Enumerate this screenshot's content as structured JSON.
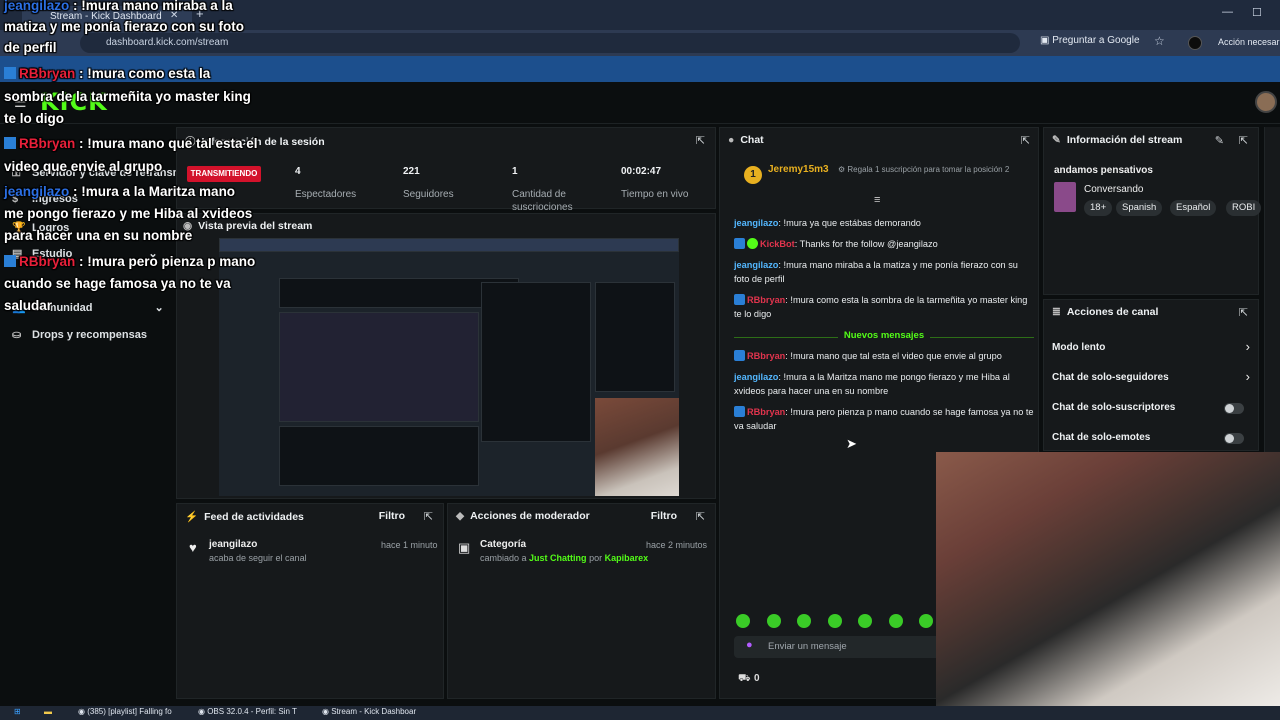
{
  "browser": {
    "tab_title": "Stream - Kick Dashboard",
    "url": "dashboard.kick.com/stream",
    "google_btn": "Preguntar a Google",
    "accion": "Acción necesaria"
  },
  "kick": {
    "logo": "KICK"
  },
  "sidebar": {
    "items": [
      {
        "label": "Servidor y clave de retransm",
        "icon": "key-icon"
      },
      {
        "label": "Ingresos",
        "icon": "money-icon"
      },
      {
        "label": "Logros",
        "icon": "trophy-icon"
      },
      {
        "label": "Estudio",
        "icon": "studio-icon"
      },
      {
        "label": "Comunidad",
        "icon": "users-icon"
      },
      {
        "label": "Drops y recompensas",
        "icon": "gift-icon"
      }
    ]
  },
  "session": {
    "title": "Información de la sesión",
    "status": "TRANSMITIENDO",
    "stats": [
      {
        "value": "4",
        "label": "Espectadores"
      },
      {
        "value": "221",
        "label": "Seguidores"
      },
      {
        "value": "1",
        "label": "Cantidad de suscriociones"
      },
      {
        "value": "00:02:47",
        "label": "Tiempo en vivo"
      }
    ]
  },
  "preview": {
    "title": "Vista previa del stream"
  },
  "activity": {
    "title": "Feed de actividades",
    "filter": "Filtro",
    "item": {
      "user": "jeangilazo",
      "action": "acaba de seguir el canal",
      "time": "hace 1 minuto"
    }
  },
  "modactions": {
    "title": "Acciones de moderador",
    "filter": "Filtro",
    "item": {
      "title": "Categoría",
      "prefix": "cambiado a",
      "category": "Just Chatting",
      "by": "por",
      "mod": "Kapibarex",
      "time": "hace 2 minutos"
    }
  },
  "chat": {
    "title": "Chat",
    "pinned_user": "Jeremy15m3",
    "pinned_rank": "1",
    "gift_text": "Regala 1 suscripción para tomar la posición 2",
    "new_messages": "Nuevos mensajes",
    "input_placeholder": "Enviar un mensaje",
    "count": "0",
    "messages": [
      {
        "user": "jeangilazo",
        "text": "!mura ya que estábas demorando"
      },
      {
        "user": "KickBot",
        "text": "Thanks for the follow @jeangilazo"
      },
      {
        "user": "jeangilazo",
        "text": "!mura mano miraba a la matiza y me ponía fierazo con su foto de perfil"
      },
      {
        "user": "RBbryan",
        "text": "!mura como esta la sombra de la tarmeñita yo master king te lo digo"
      },
      {
        "user": "RBbryan",
        "text": "!mura mano que tal esta el video que envie al grupo"
      },
      {
        "user": "jeangilazo",
        "text": "!mura a la Maritza mano me pongo fierazo y me Hiba al xvideos para hacer una en su nombre"
      },
      {
        "user": "RBbryan",
        "text": "!mura pero pienza p mano cuando se hage famosa ya no te va saludar"
      }
    ]
  },
  "streaminfo": {
    "title": "Información del stream",
    "stream_title": "andamos pensativos",
    "category": "Conversando",
    "tags": [
      "18+",
      "Spanish",
      "Español",
      "ROBI"
    ]
  },
  "channel": {
    "title": "Acciones de canal",
    "actions": [
      "Modo lento",
      "Chat de solo-seguidores",
      "Chat de solo-suscriptores",
      "Chat de solo-emotes"
    ]
  },
  "overlay": {
    "lines": [
      {
        "user": "jeangilazo",
        "text": " : !mura mano miraba a la",
        "cont": [
          "matiza y me ponía fierazo con su foto",
          "de perfil"
        ]
      },
      {
        "user": "RBbryan",
        "text": " : !mura como esta la",
        "cont": [
          "sombra de la tarmeñita yo master king",
          "te lo digo"
        ]
      },
      {
        "user": "RBbryan",
        "text": " : !mura mano que tal esta el",
        "cont": [
          "video que envie al grupo"
        ]
      },
      {
        "user": "jeangilazo",
        "text": " : !mura a la Maritza mano",
        "cont": [
          "me pongo fierazo y me Hiba al xvideos",
          "para hacer una en su nombre"
        ]
      },
      {
        "user": "RBbryan",
        "text": " : !mura pero pienza p mano",
        "cont": [
          "cuando se hage famosa ya no te va",
          "saludar"
        ]
      }
    ]
  },
  "taskbar": {
    "items": [
      "(385) [playlist] Falling fo",
      "OBS 32.0.4 - Perfil: Sin T",
      "Stream - Kick Dashboar"
    ]
  }
}
